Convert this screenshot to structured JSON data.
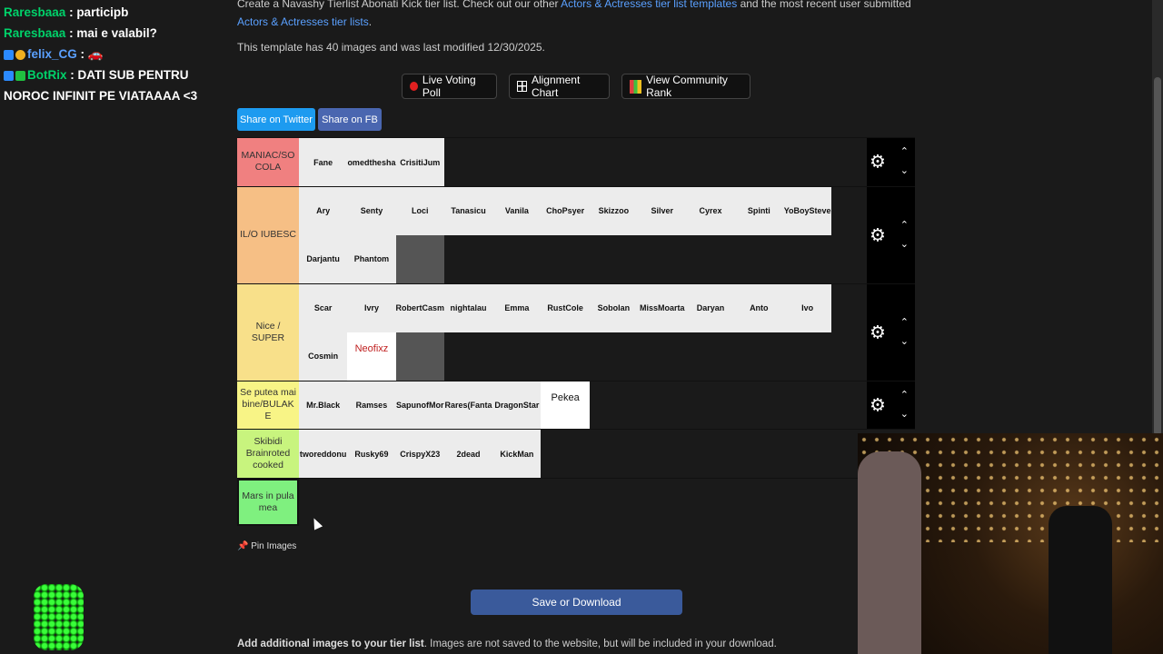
{
  "chat": [
    {
      "user": "Raresbaaa",
      "message": "participb",
      "color": "#00d26a",
      "badges": []
    },
    {
      "user": "Raresbaaa",
      "message": "mai e valabil?",
      "color": "#00d26a",
      "badges": []
    },
    {
      "user": "felix_CG",
      "message": "",
      "color": "#5aa0ff",
      "badges": [
        "blue-gem-badge",
        "gold-one-badge"
      ]
    },
    {
      "user": "BotRix",
      "message": "DATI SUB PENTRU NOROC INFINIT PE VIATAAAA <3",
      "color": "#00d26a",
      "badges": [
        "bot-badge",
        "verified-badge"
      ]
    }
  ],
  "intro": {
    "text_start": "Create a Navashy Tierlist Abonati Kick tier list. Check out our other ",
    "link1": "Actors & Actresses tier list templates",
    "text_mid": " and the most recent user submitted ",
    "link2": "Actors & Actresses tier lists",
    "text_end": "."
  },
  "meta_text": "This template has 40 images and was last modified 12/30/2025.",
  "buttons": {
    "live_voting": "Live Voting Poll",
    "alignment": "Alignment Chart",
    "community": "View Community Rank",
    "share_twitter": "Share on Twitter",
    "share_fb": "Share on FB"
  },
  "tiers": [
    {
      "label": "MANIAC/SO COLA",
      "color": "#f08080",
      "rows": 1,
      "items": [
        {
          "t": "Fane"
        },
        {
          "t": "omedthesha"
        },
        {
          "t": "CrisitiJum"
        }
      ]
    },
    {
      "label": "IL/O IUBESC",
      "color": "#f6bf85",
      "rows": 2,
      "items": [
        {
          "t": "Ary"
        },
        {
          "t": "Senty"
        },
        {
          "t": "Loci"
        },
        {
          "t": "Tanasicu"
        },
        {
          "t": "Vanila"
        },
        {
          "t": "ChoPsyer"
        },
        {
          "t": "Skizzoo"
        },
        {
          "t": "Silver"
        },
        {
          "t": "Cyrex"
        },
        {
          "t": "Spinti"
        },
        {
          "t": "YoBoySteve"
        },
        {
          "t": "Darjantu"
        },
        {
          "t": "Phantom"
        },
        {
          "t": "",
          "img": true
        }
      ]
    },
    {
      "label": "Nice / SUPER",
      "color": "#f8e08a",
      "rows": 2,
      "items": [
        {
          "t": "Scar"
        },
        {
          "t": "Ivry"
        },
        {
          "t": "RobertCasm"
        },
        {
          "t": "nightalau"
        },
        {
          "t": "Emma"
        },
        {
          "t": "RustCole"
        },
        {
          "t": "Sobolan"
        },
        {
          "t": "MissMoarta"
        },
        {
          "t": "Daryan"
        },
        {
          "t": "Anto"
        },
        {
          "t": "Ivo"
        },
        {
          "t": "Cosmin"
        },
        {
          "t": "Neofixz",
          "white": true
        },
        {
          "t": "",
          "img": true
        },
        {
          "t": "",
          "img": true,
          "dark": true
        }
      ]
    },
    {
      "label": "Se putea mai bine/BULAK E",
      "color": "#f8f486",
      "rows": 1,
      "items": [
        {
          "t": "Mr.Black"
        },
        {
          "t": "Ramses"
        },
        {
          "t": "SapunofMor"
        },
        {
          "t": "Rares(Fanta"
        },
        {
          "t": "DragonStar"
        },
        {
          "t": "Pekea",
          "white": true
        }
      ]
    },
    {
      "label": "Skibidi Brainroted cooked",
      "color": "#c8f47e",
      "rows": 1,
      "items": [
        {
          "t": "tworeddonu"
        },
        {
          "t": "Rusky69"
        },
        {
          "t": "CrispyX23"
        },
        {
          "t": "2dead"
        },
        {
          "t": "KickMan"
        }
      ]
    },
    {
      "label": "Mars in pula mea",
      "color": "#7ff07f",
      "rows": 1,
      "items": []
    }
  ],
  "pin_label": "Pin Images",
  "save_label": "Save or Download",
  "add_images": {
    "bold": "Add additional images to your tier list",
    "rest": ". Images are not saved to the website, but will be included in your download."
  }
}
